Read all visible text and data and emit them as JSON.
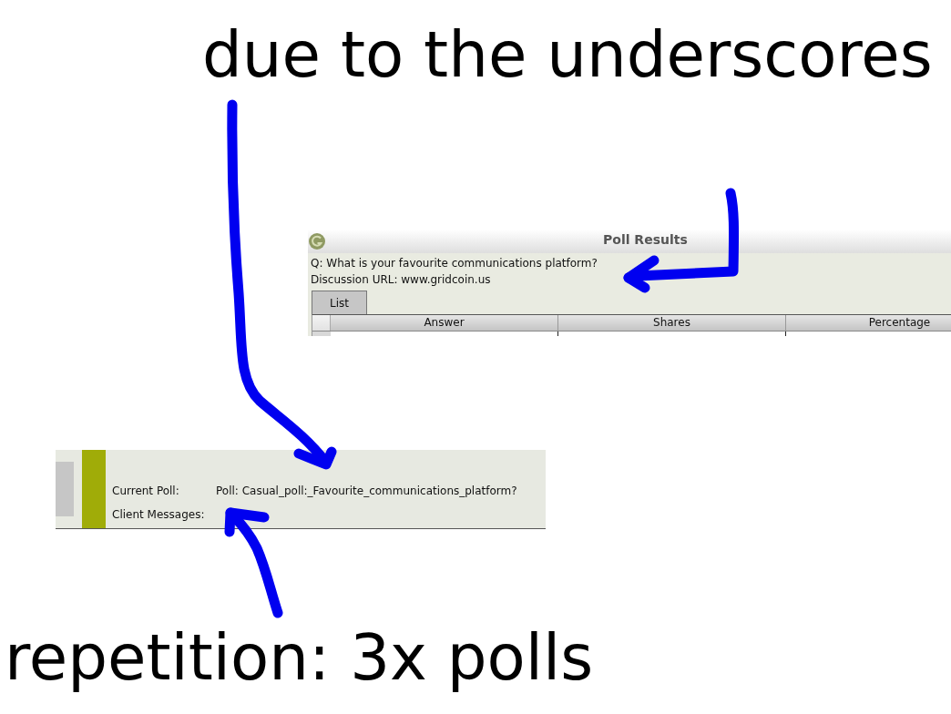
{
  "annotations": [
    {
      "text": "due to the underscores"
    },
    {
      "text": "repetition: 3x polls"
    }
  ],
  "poll_results_window": {
    "title": "Poll Results",
    "question": "Q: What is your favourite communications platform?",
    "discussion_url": "Discussion URL: www.gridcoin.us",
    "tabs": [
      {
        "label": "List",
        "selected": true
      }
    ],
    "table": {
      "columns": [
        "Answer",
        "Shares",
        "Percentage"
      ]
    }
  },
  "status_panel": {
    "rows": [
      {
        "label": "Current Poll:",
        "value": "Poll: Casual_poll:_Favourite_communications_platform?"
      },
      {
        "label": "Client Messages:"
      }
    ]
  }
}
